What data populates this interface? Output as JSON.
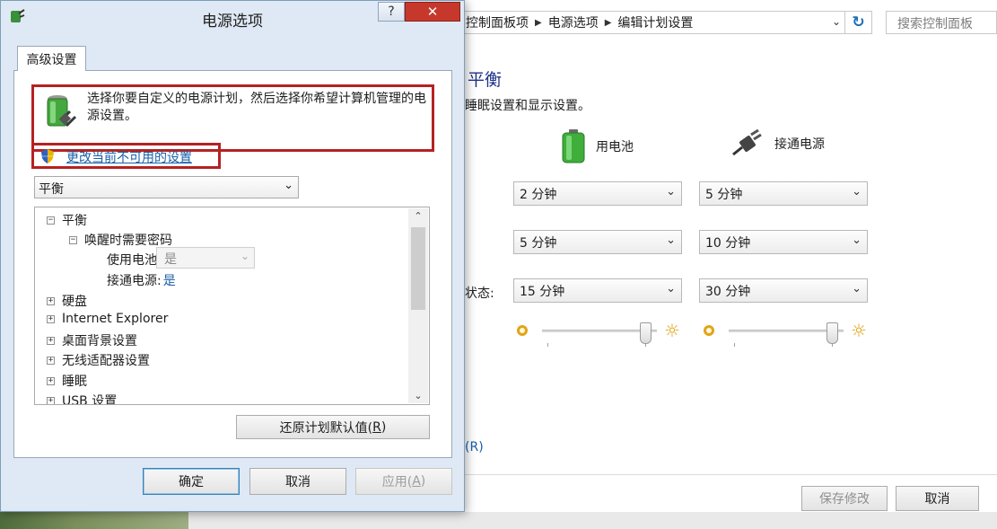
{
  "background_window": {
    "breadcrumbs": [
      "控制面板项",
      "电源选项",
      "编辑计划设置"
    ],
    "search_placeholder": "搜索控制面板",
    "plan_title": "平衡",
    "plan_subtitle": "睡眠设置和显示设置。",
    "columns": {
      "battery": "用电池",
      "plugged_in": "接通电源"
    },
    "rows": [
      {
        "label": "",
        "battery": "2 分钟",
        "plugged_in": "5 分钟"
      },
      {
        "label": "",
        "battery": "5 分钟",
        "plugged_in": "10 分钟"
      },
      {
        "label": "状态:",
        "battery": "15 分钟",
        "plugged_in": "30 分钟"
      }
    ],
    "brightness": {
      "battery_level": 0.85,
      "plugged_in_level": 0.85
    },
    "restore_link_partial": "(R)",
    "save_button": "保存修改",
    "cancel_button": "取消"
  },
  "dialog": {
    "title": "电源选项",
    "help_label": "?",
    "close_label": "✕",
    "tab": "高级设置",
    "intro_text": "选择你要自定义的电源计划，然后选择你希望计算机管理的电源设置。",
    "change_link": "更改当前不可用的设置",
    "plan_select": "平衡",
    "tree": [
      {
        "label": "平衡",
        "expander": "⊟",
        "level": 0
      },
      {
        "label": "唤醒时需要密码",
        "expander": "⊟",
        "level": 1
      },
      {
        "label": "使用电池:",
        "value": "是",
        "level": 2,
        "type": "combo"
      },
      {
        "label": "接通电源:",
        "value": "是",
        "level": 2,
        "type": "value"
      },
      {
        "label": "硬盘",
        "expander": "⊞",
        "level": 0
      },
      {
        "label": "Internet Explorer",
        "expander": "⊞",
        "level": 0
      },
      {
        "label": "桌面背景设置",
        "expander": "⊞",
        "level": 0
      },
      {
        "label": "无线适配器设置",
        "expander": "⊞",
        "level": 0
      },
      {
        "label": "睡眠",
        "expander": "⊞",
        "level": 0
      },
      {
        "label": "USB 设置",
        "expander": "⊞",
        "level": 0
      }
    ],
    "restore_defaults": {
      "text": "还原计划默认值(",
      "key": "R",
      "close": ")"
    },
    "ok_button": "确定",
    "cancel_button": "取消",
    "apply_button": {
      "text": "应用(",
      "key": "A",
      "close": ")"
    }
  },
  "colors": {
    "accent_red_box": "#b52222",
    "link": "#1a5ea8",
    "title_blue": "#1e3287"
  }
}
